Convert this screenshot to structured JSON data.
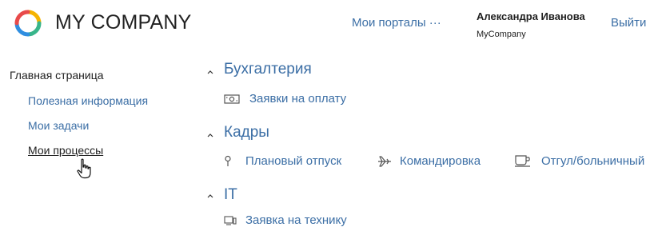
{
  "header": {
    "logo_icon": "colorful-ring-logo",
    "brand": "MY COMPANY",
    "portals_link": "Мои порталы ···",
    "user_name": "Александра Иванова",
    "user_company": "MyCompany",
    "logout": "Выйти"
  },
  "sidebar": {
    "home": "Главная страница",
    "items": [
      {
        "label": "Полезная информация"
      },
      {
        "label": "Мои задачи"
      },
      {
        "label": "Мои процессы",
        "active": true
      }
    ]
  },
  "sections": [
    {
      "title": "Бухгалтерия",
      "items": [
        {
          "label": "Заявки на оплату",
          "icon": "banknote-icon"
        }
      ]
    },
    {
      "title": "Кадры",
      "items": [
        {
          "label": "Плановый отпуск",
          "icon": "pin-icon"
        },
        {
          "label": "Командировка",
          "icon": "airplane-icon"
        },
        {
          "label": "Отгул/больничный",
          "icon": "coffee-cup-icon"
        }
      ]
    },
    {
      "title": "IT",
      "items": [
        {
          "label": "Заявка на технику",
          "icon": "computer-icon"
        }
      ]
    }
  ],
  "colors": {
    "link": "#3b6ea5",
    "text": "#1f1f1f"
  }
}
